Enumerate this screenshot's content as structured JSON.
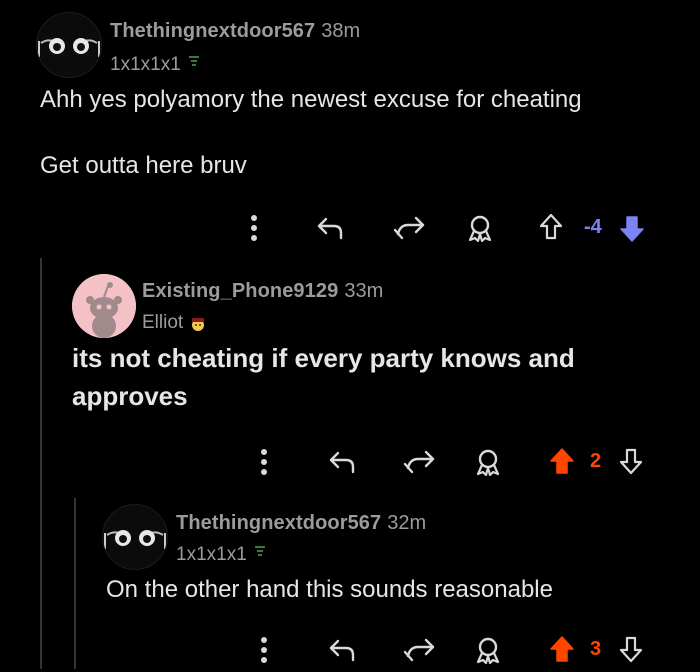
{
  "comments": [
    {
      "username": "Thethingnextdoor567",
      "time": "38m",
      "flair": "1x1x1x1",
      "body_lines": [
        "Ahh yes polyamory the newest excuse for cheating",
        "Get outta here bruv"
      ],
      "score": "-4",
      "vote_state": "downvoted",
      "score_color": "#7b83f5"
    },
    {
      "username": "Existing_Phone9129",
      "time": "33m",
      "flair": "Elliot",
      "body_lines": [
        "its not cheating if every party knows and",
        "approves"
      ],
      "score": "2",
      "vote_state": "upvoted",
      "score_color": "#ff4500"
    },
    {
      "username": "Thethingnextdoor567",
      "time": "32m",
      "flair": "1x1x1x1",
      "body_lines": [
        "On the other hand this sounds reasonable"
      ],
      "score": "3",
      "vote_state": "upvoted",
      "score_color": "#ff4500"
    }
  ],
  "icons": [
    "more-icon",
    "reply-icon",
    "share-icon",
    "award-icon",
    "upvote-icon",
    "downvote-icon"
  ],
  "colors": {
    "background": "#000000",
    "text": "#e4e6e8",
    "muted": "#9a9c9e",
    "upvote": "#ff4500",
    "downvote": "#7b83f5"
  }
}
